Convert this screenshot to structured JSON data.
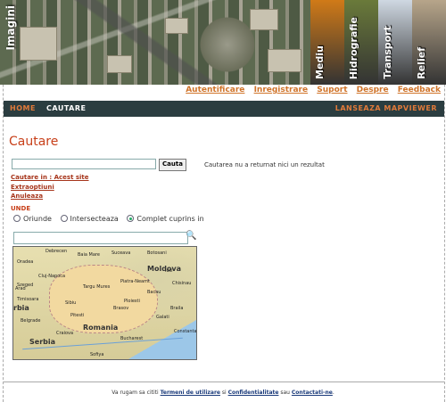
{
  "banner": {
    "main_label": "Imagini",
    "tiles": [
      {
        "label": "Mediu",
        "color": "#d07a18"
      },
      {
        "label": "Hidrografie",
        "color": "#6a7a3a"
      },
      {
        "label": "Transport",
        "color": "#cfd8e2"
      },
      {
        "label": "Relief",
        "color": "#b7a58a"
      }
    ]
  },
  "toplinks": [
    "Autentificare",
    "Inregistrare",
    "Suport",
    "Despre",
    "Feedback"
  ],
  "nav": {
    "home": "HOME",
    "cautare": "CAUTARE",
    "mapviewer": "LANSEAZA MAPVIEWER"
  },
  "page_title": "Cautare",
  "search": {
    "value": "",
    "button": "Cauta"
  },
  "result_text": "Cautarea nu a returnat nici un rezultat",
  "options": {
    "cautare_in": "Cautare in : Acest site",
    "extraoptiuni": "Extraoptiuni",
    "anuleaza": "Anuleaza"
  },
  "unde_label": "UNDE",
  "radios": [
    {
      "label": "Oriunde",
      "selected": false
    },
    {
      "label": "Intersecteaza",
      "selected": false
    },
    {
      "label": "Complet cuprins in",
      "selected": true
    }
  ],
  "map": {
    "countries": [
      "Moldova",
      "Serbia",
      "Romania",
      "rbia"
    ],
    "cities": [
      "Oradea",
      "Baia Mare",
      "Suceava",
      "Botosani",
      "Cluj-Napoca",
      "Targu Mures",
      "Iasi",
      "Piatra-Neamt",
      "Arad",
      "Timisoara",
      "Sibiu",
      "Brasov",
      "Bacau",
      "Galati",
      "Braila",
      "Pitesti",
      "Ploiesti",
      "Craiova",
      "Bucharest",
      "Constanta",
      "Belgrade",
      "Szeged",
      "Debrecen",
      "Chisinau",
      "Sofiya"
    ]
  },
  "footer": {
    "prefix": "Va rugam sa cititi",
    "terms": "Termeni de utilizare",
    "si": "si",
    "conf": "Confidentialitate",
    "sau": "sau",
    "contact": "Contactati-ne"
  }
}
